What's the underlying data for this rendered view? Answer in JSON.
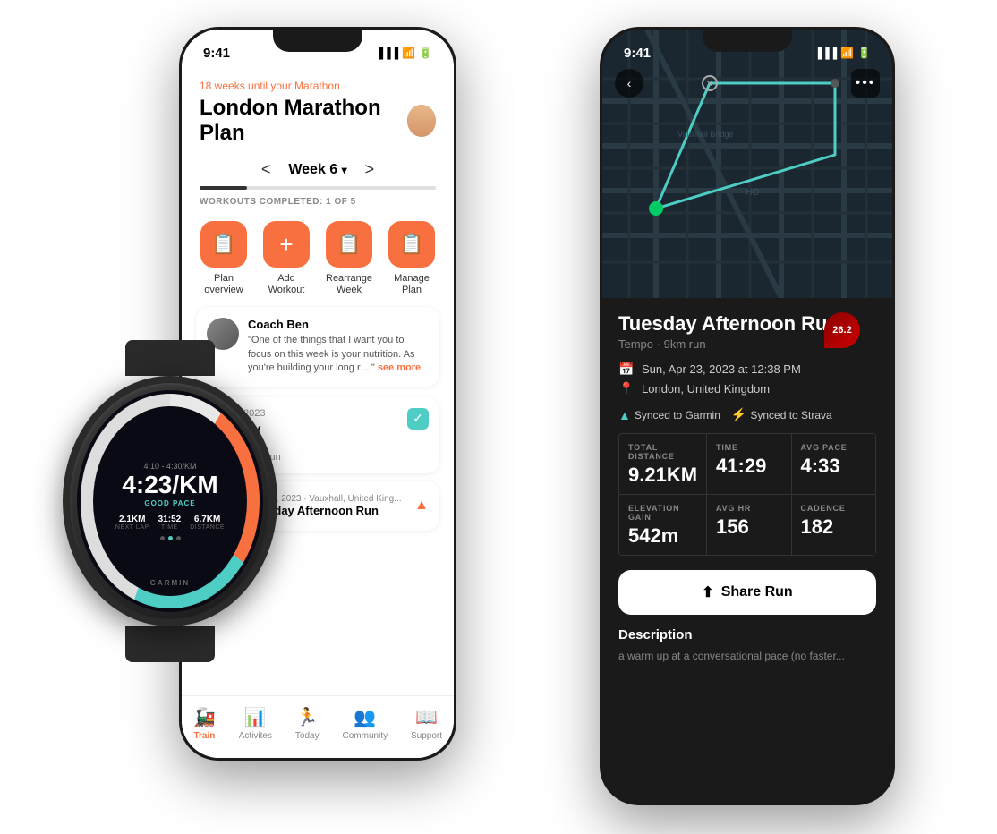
{
  "leftPhone": {
    "status": {
      "time": "9:41"
    },
    "header": {
      "subtitle": "18 weeks until your Marathon",
      "title": "London Marathon Plan",
      "weekNav": {
        "prev": "<",
        "current": "Week 6",
        "next": ">"
      }
    },
    "progress": {
      "label": "WORKOUTS COMPLETED: 1 OF 5",
      "percent": 20
    },
    "actions": [
      {
        "icon": "📋",
        "label": "Plan overview"
      },
      {
        "icon": "+",
        "label": "Add Workout"
      },
      {
        "icon": "📋",
        "label": "Rearrange Week"
      },
      {
        "icon": "📋",
        "label": "Manage Plan"
      }
    ],
    "coach": {
      "name": "Coach Ben",
      "quote": "\"One of the things that I want you to focus on this week is your nutrition. As you're building your long r ...\"",
      "seeMore": "see more"
    },
    "workoutCard": {
      "date": "Dec 18, 2023",
      "day": "Monday",
      "type": "Tempo Run",
      "desc": "Tempo • 9km run",
      "completed": true
    },
    "activityRow": {
      "date": "Dec 19, 2023 · Vauxhall, United King...",
      "name": "Tuesday Afternoon Run",
      "hasStrava": true
    },
    "tabs": [
      {
        "icon": "🚂",
        "label": "Train",
        "active": true
      },
      {
        "icon": "📊",
        "label": "Activites",
        "active": false
      },
      {
        "icon": "🏃",
        "label": "Today",
        "active": false
      },
      {
        "icon": "👥",
        "label": "Community",
        "active": false
      },
      {
        "icon": "📖",
        "label": "Support",
        "active": false
      }
    ]
  },
  "rightPhone": {
    "status": {
      "time": "9:41"
    },
    "runTitle": "Tuesday Afternoon Run",
    "runSubtitle": "Tempo",
    "runDistance": "9km run",
    "meta": {
      "date": "Sun, Apr 23, 2023 at 12:38 PM",
      "location": "London, United Kingdom",
      "syncGarmin": "Synced to Garmin",
      "syncStrava": "Synced to Strava"
    },
    "badge": "26.2",
    "stats": [
      {
        "label": "TOTAL DISTANCE",
        "value": "9.21KM"
      },
      {
        "label": "TIME",
        "value": "41:29"
      },
      {
        "label": "AVG PACE",
        "value": "4:33"
      },
      {
        "label": "ELEVATION GAIN",
        "value": "542m"
      },
      {
        "label": "AVG HR",
        "value": "156"
      },
      {
        "label": "CADENCE",
        "value": "182"
      }
    ],
    "shareButton": "Share Run",
    "description": {
      "title": "Description",
      "text": "a warm up at a conversational pace (no faster..."
    }
  },
  "watch": {
    "paceRange": "4:10 - 4:30/KM",
    "mainPace": "4:23/KM",
    "paceLabel": "GOOD PACE",
    "stats": [
      {
        "value": "2.1KM",
        "label": "NEXT LAP"
      },
      {
        "value": "31:52",
        "label": "TIME"
      },
      {
        "value": "6.7KM",
        "label": "DISTANCE"
      }
    ],
    "brand": "GARMIN"
  }
}
